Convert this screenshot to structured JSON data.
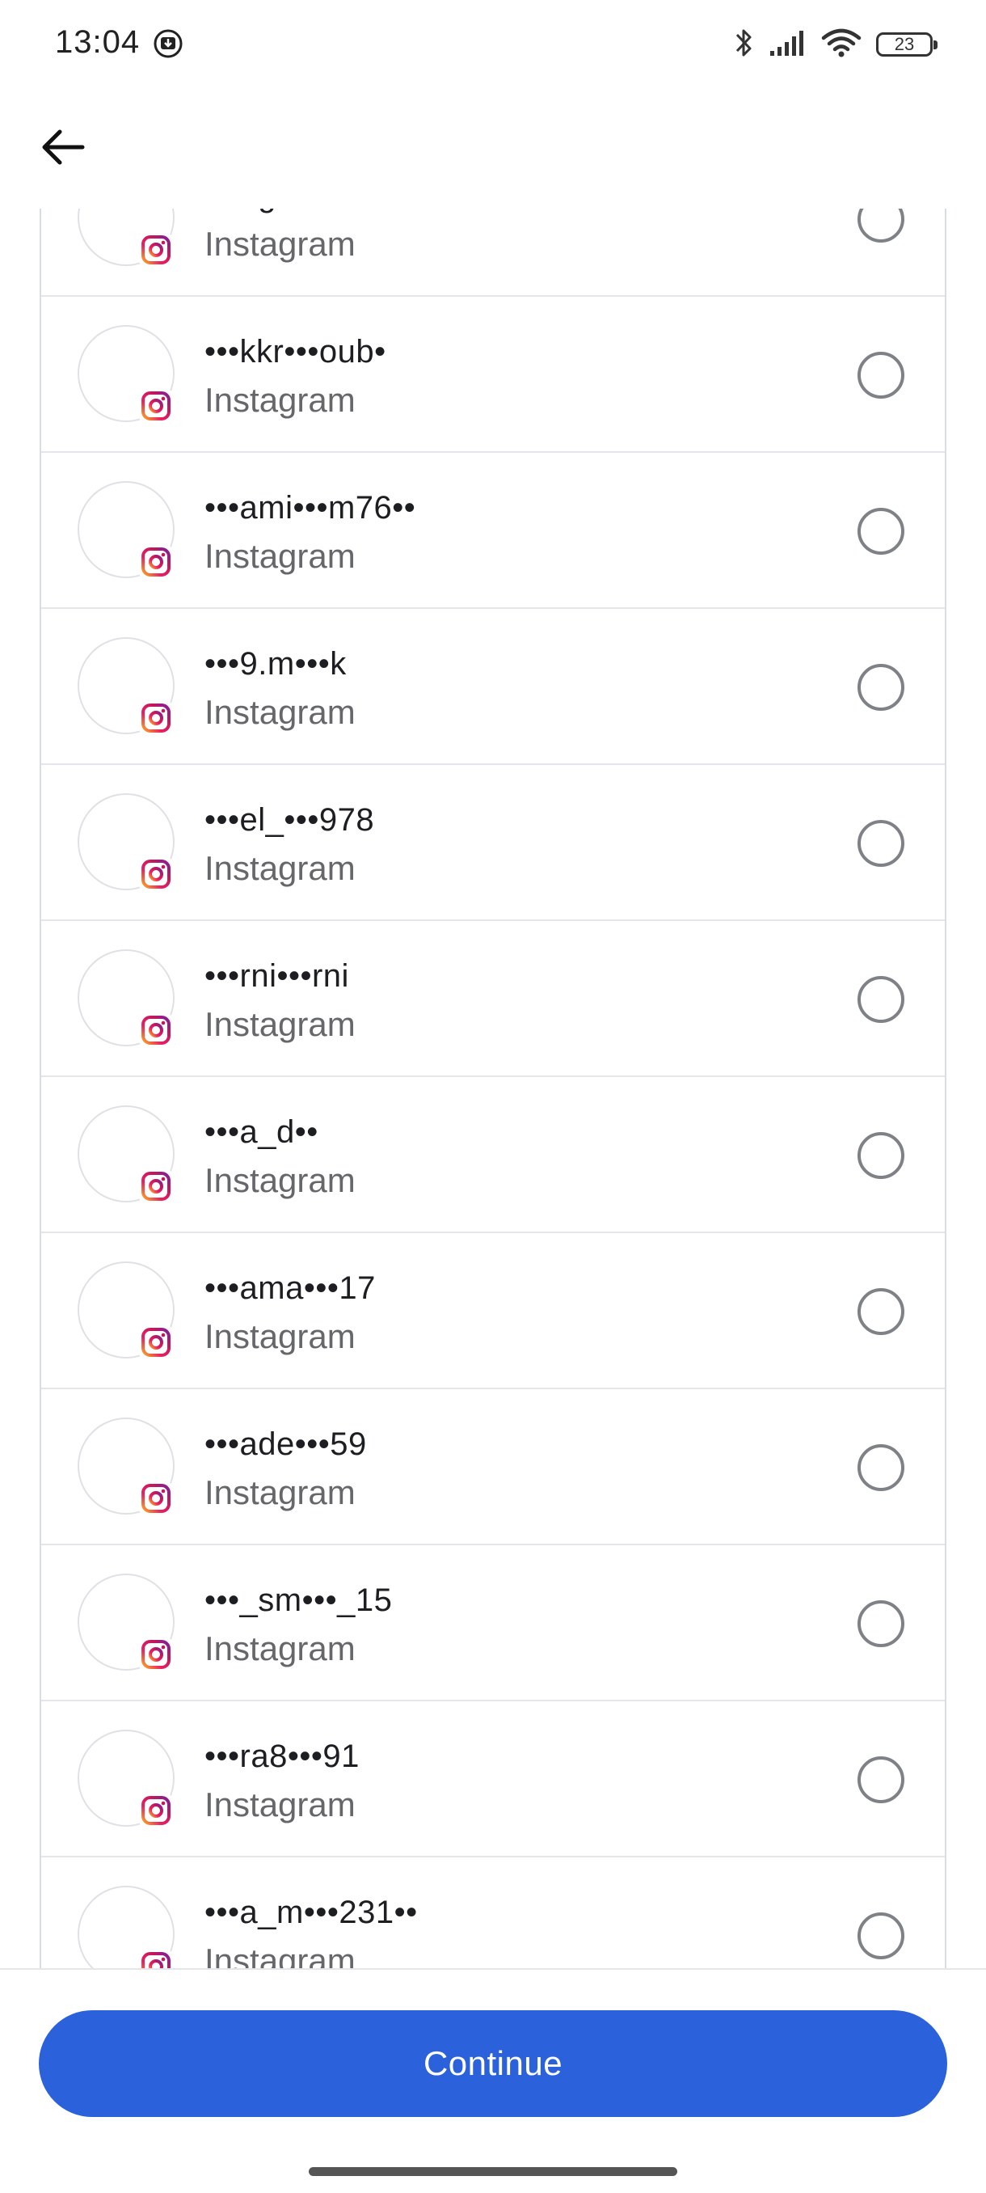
{
  "status_bar": {
    "time": "13:04",
    "battery_level": "23",
    "icons": [
      "download-notification-icon",
      "bluetooth-icon",
      "signal-icon",
      "wifi-icon",
      "battery-icon"
    ]
  },
  "header": {
    "back_icon": "arrow-left-icon"
  },
  "accounts": [
    {
      "username": "•••ng•••",
      "platform": "Instagram",
      "selected": false
    },
    {
      "username": "•••kkr•••oub•",
      "platform": "Instagram",
      "selected": false
    },
    {
      "username": "•••ami•••m76••",
      "platform": "Instagram",
      "selected": false
    },
    {
      "username": "•••9.m•••k",
      "platform": "Instagram",
      "selected": false
    },
    {
      "username": "•••el_•••978",
      "platform": "Instagram",
      "selected": false
    },
    {
      "username": "•••rni•••rni",
      "platform": "Instagram",
      "selected": false
    },
    {
      "username": "•••a_d••",
      "platform": "Instagram",
      "selected": false
    },
    {
      "username": "•••ama•••17",
      "platform": "Instagram",
      "selected": false
    },
    {
      "username": "•••ade•••59",
      "platform": "Instagram",
      "selected": false
    },
    {
      "username": "•••_sm•••_15",
      "platform": "Instagram",
      "selected": false
    },
    {
      "username": "•••ra8•••91",
      "platform": "Instagram",
      "selected": false
    },
    {
      "username": "•••a_m•••231••",
      "platform": "Instagram",
      "selected": false
    },
    {
      "username": "",
      "platform": "",
      "selected": false
    }
  ],
  "footer": {
    "continue_label": "Continue"
  },
  "colors": {
    "primary": "#2b62db",
    "secondary_text": "#65676b",
    "radio_border": "#7e8186"
  }
}
